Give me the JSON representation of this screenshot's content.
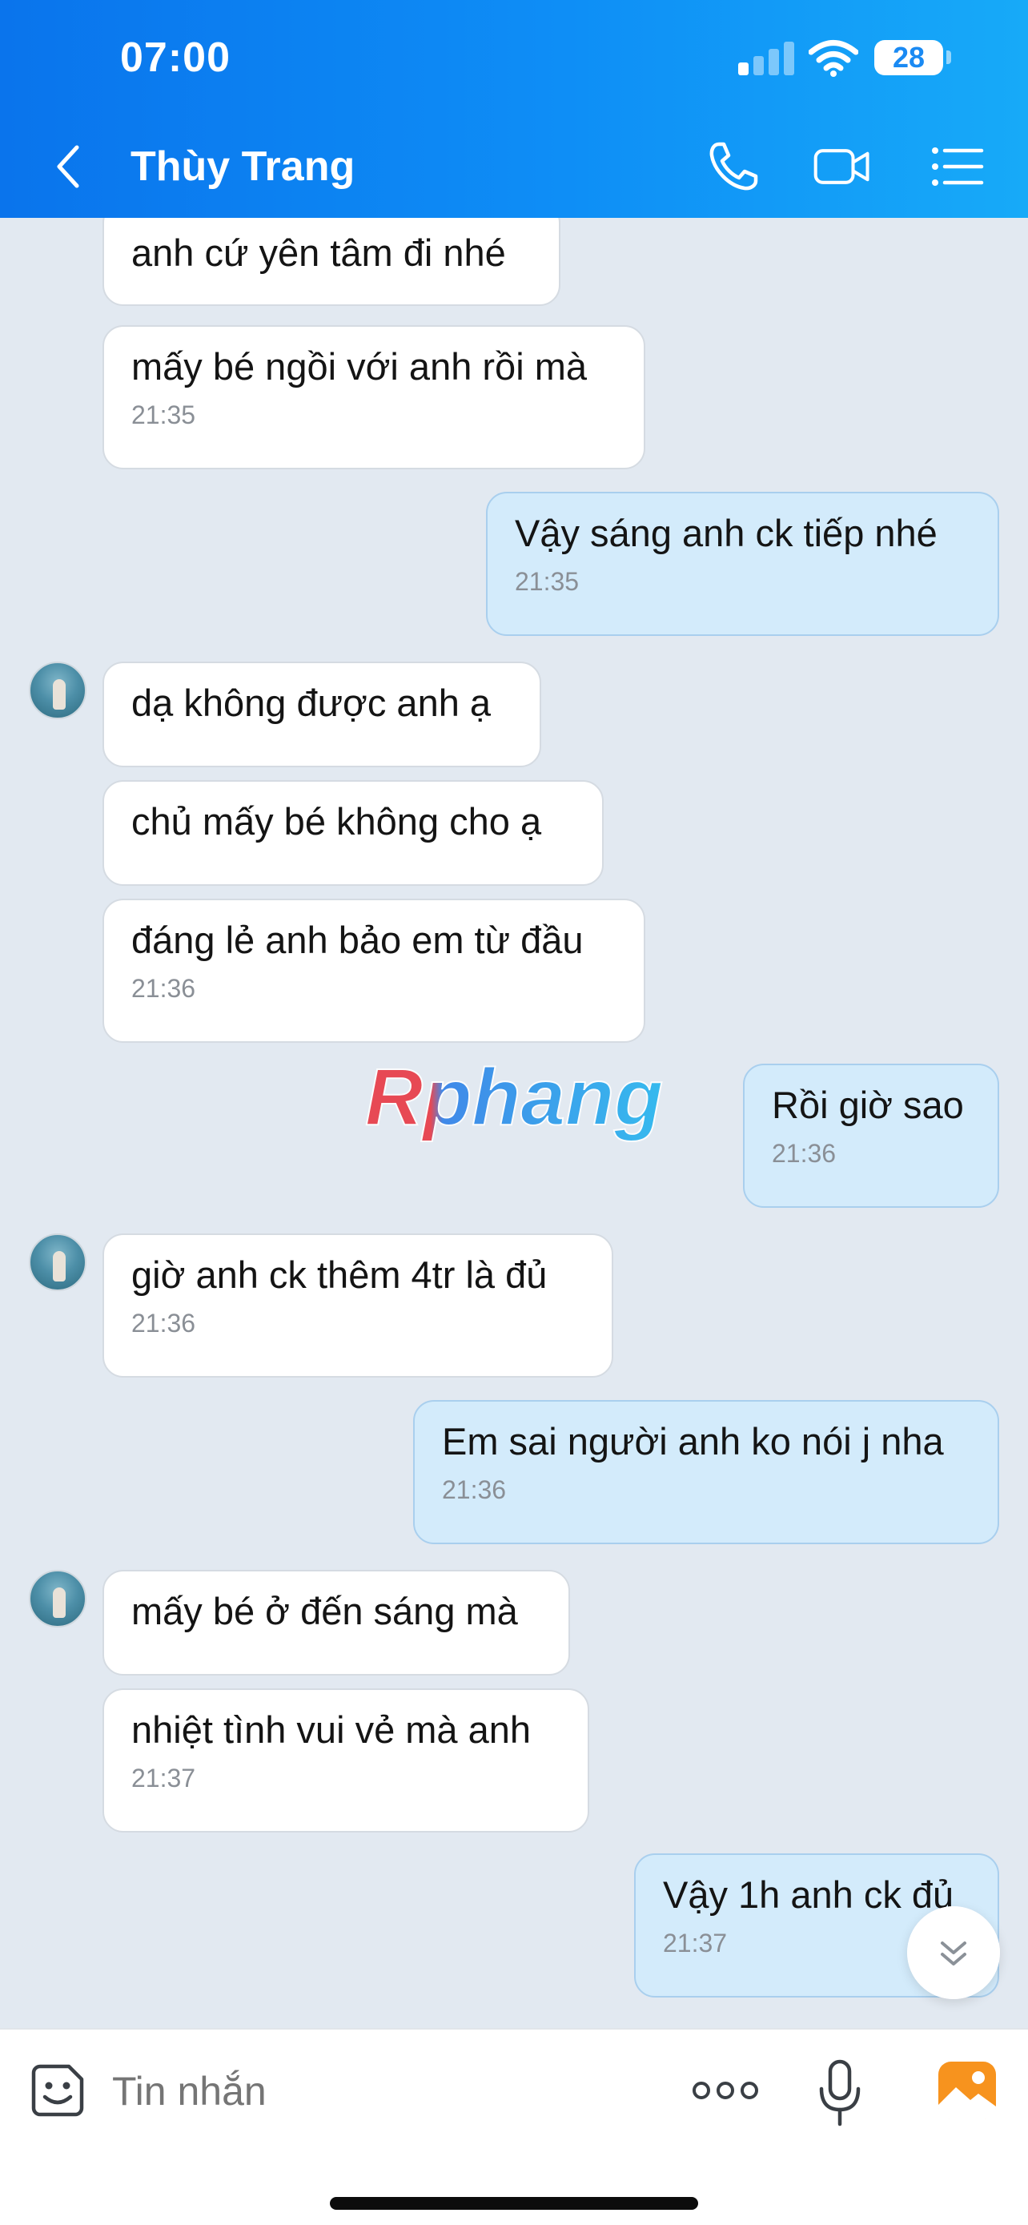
{
  "status": {
    "time": "07:00",
    "battery": "28"
  },
  "header": {
    "contact_name": "Thùy Trang"
  },
  "watermark": {
    "text": "Rphang"
  },
  "messages": [
    {
      "dir": "in",
      "text": "anh cứ yên tâm đi nhé",
      "time": ""
    },
    {
      "dir": "in",
      "text": "mấy bé ngồi với anh rồi mà",
      "time": "21:35"
    },
    {
      "dir": "out",
      "text": "Vậy sáng anh ck tiếp nhé",
      "time": "21:35"
    },
    {
      "dir": "in",
      "text": "dạ không được anh ạ",
      "time": ""
    },
    {
      "dir": "in",
      "text": "chủ mấy bé không cho ạ",
      "time": ""
    },
    {
      "dir": "in",
      "text": "đáng lẻ anh bảo em từ đầu",
      "time": "21:36"
    },
    {
      "dir": "out",
      "text": "Rồi giờ sao",
      "time": "21:36"
    },
    {
      "dir": "in",
      "text": "giờ anh ck thêm 4tr là đủ",
      "time": "21:36"
    },
    {
      "dir": "out",
      "text": "Em sai người anh ko nói j nha",
      "time": "21:36"
    },
    {
      "dir": "in",
      "text": "mấy bé ở đến sáng mà",
      "time": ""
    },
    {
      "dir": "in",
      "text": "nhiệt tình vui vẻ mà anh",
      "time": "21:37"
    },
    {
      "dir": "out",
      "text": "Vậy 1h anh ck đủ",
      "time": "21:37"
    }
  ],
  "input": {
    "placeholder": "Tin nhắn"
  },
  "icons": {
    "back": "chevron-left-icon",
    "call": "phone-icon",
    "video": "video-camera-icon",
    "options": "list-icon",
    "scroll_down": "double-chevron-down-icon",
    "emoji": "sticker-icon",
    "more": "more-dots-icon",
    "mic": "microphone-icon",
    "image": "image-icon"
  },
  "colors": {
    "header_start": "#0a74ec",
    "header_end": "#17aaf8",
    "chat_background": "#e2e9f1",
    "outgoing_bubble": "#d3ebfb",
    "incoming_bubble": "#ffffff",
    "image_button": "#f7931e"
  }
}
